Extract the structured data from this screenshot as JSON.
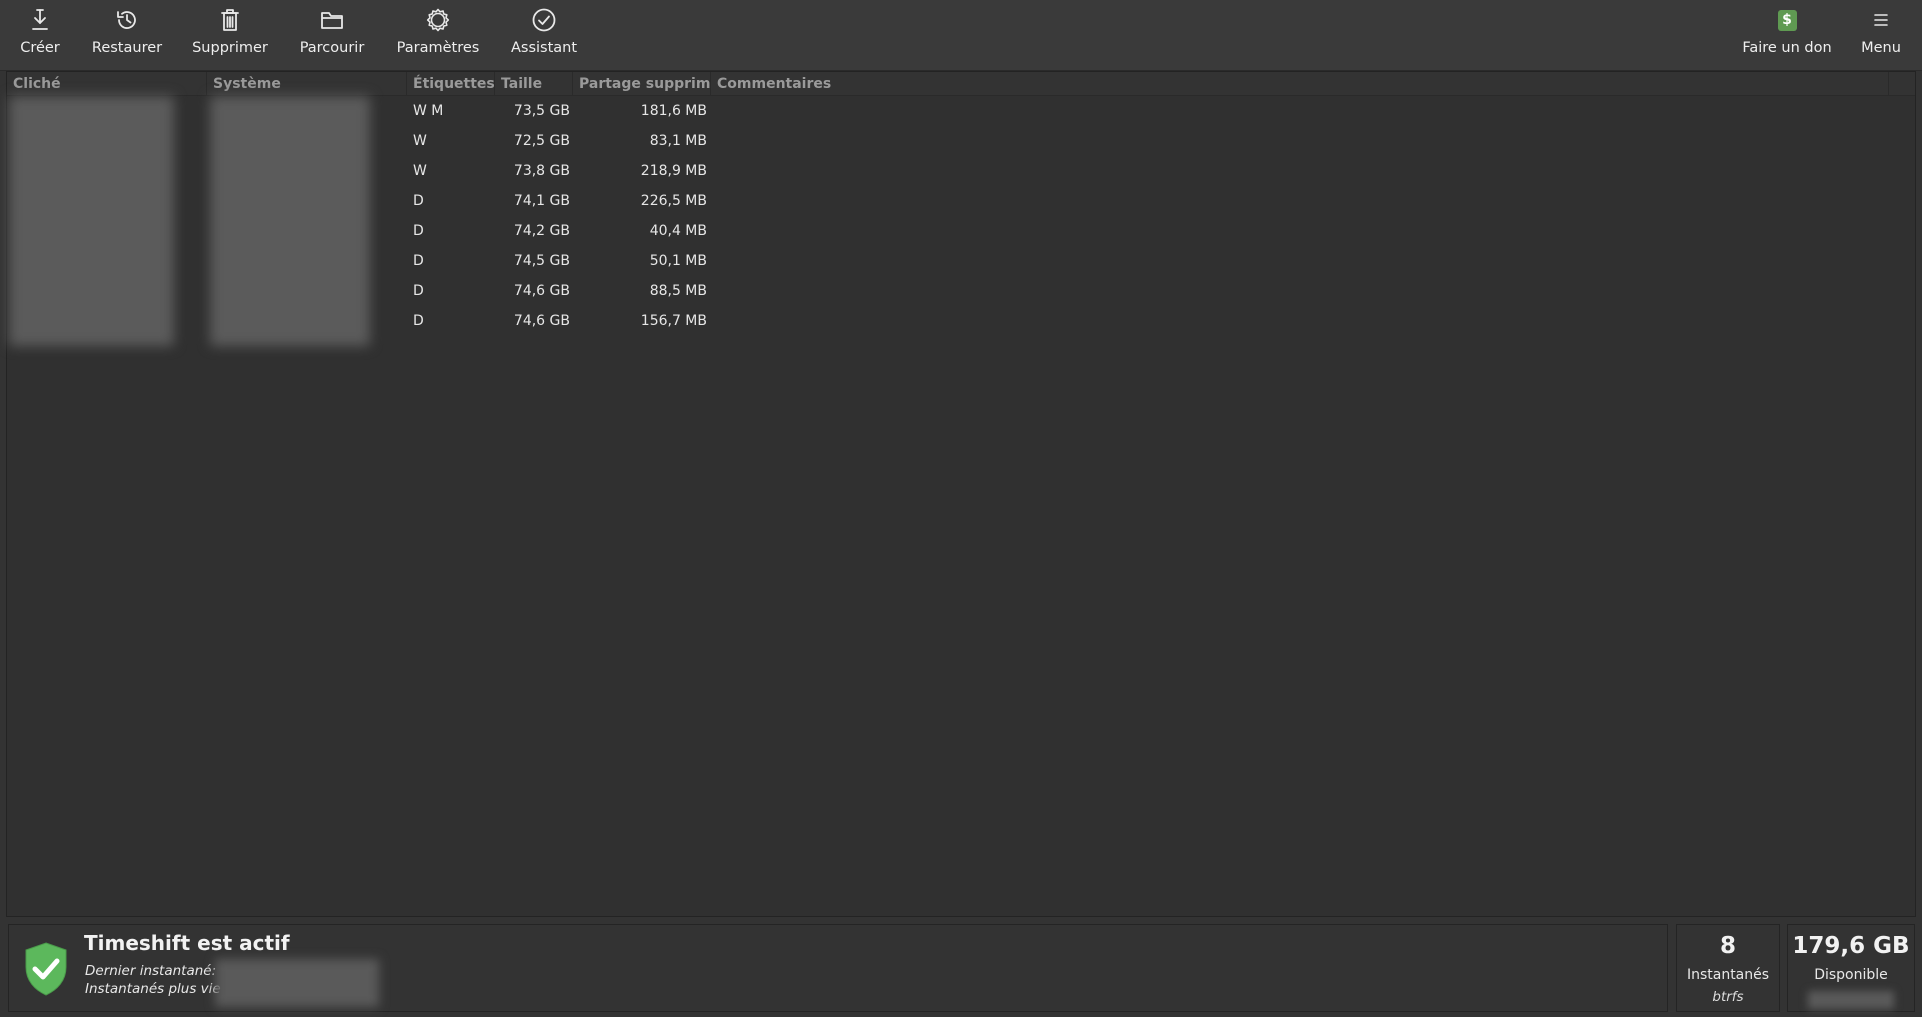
{
  "toolbar": {
    "create": "Créer",
    "restore": "Restaurer",
    "delete": "Supprimer",
    "browse": "Parcourir",
    "settings": "Paramètres",
    "wizard": "Assistant",
    "donate": "Faire un don",
    "menu": "Menu",
    "donate_icon_glyph": "$",
    "donate_icon_color": "#5f9a52"
  },
  "columns": {
    "snapshot": "Cliché",
    "system": "Système",
    "tags": "Étiquettes",
    "size": "Taille",
    "shared_deleted": "Partage supprimé",
    "comments": "Commentaires"
  },
  "rows": [
    {
      "tags": "W M",
      "size": "73,5 GB",
      "shared": "181,6 MB"
    },
    {
      "tags": "W",
      "size": "72,5 GB",
      "shared": "83,1 MB"
    },
    {
      "tags": "W",
      "size": "73,8 GB",
      "shared": "218,9 MB"
    },
    {
      "tags": "D",
      "size": "74,1 GB",
      "shared": "226,5 MB"
    },
    {
      "tags": "D",
      "size": "74,2 GB",
      "shared": "40,4 MB"
    },
    {
      "tags": "D",
      "size": "74,5 GB",
      "shared": "50,1 MB"
    },
    {
      "tags": "D",
      "size": "74,6 GB",
      "shared": "88,5 MB"
    },
    {
      "tags": "D",
      "size": "74,6 GB",
      "shared": "156,7 MB"
    }
  ],
  "status": {
    "title": "Timeshift est actif",
    "last_snapshot_label": "Dernier instantané:",
    "oldest_snapshot_label": "Instantanés plus vie",
    "shield_color": "#5cb85c"
  },
  "stats": {
    "count_value": "8",
    "count_label": "Instantanés",
    "count_sub": "btrfs",
    "free_value": "179,6 GB",
    "free_label": "Disponible"
  }
}
